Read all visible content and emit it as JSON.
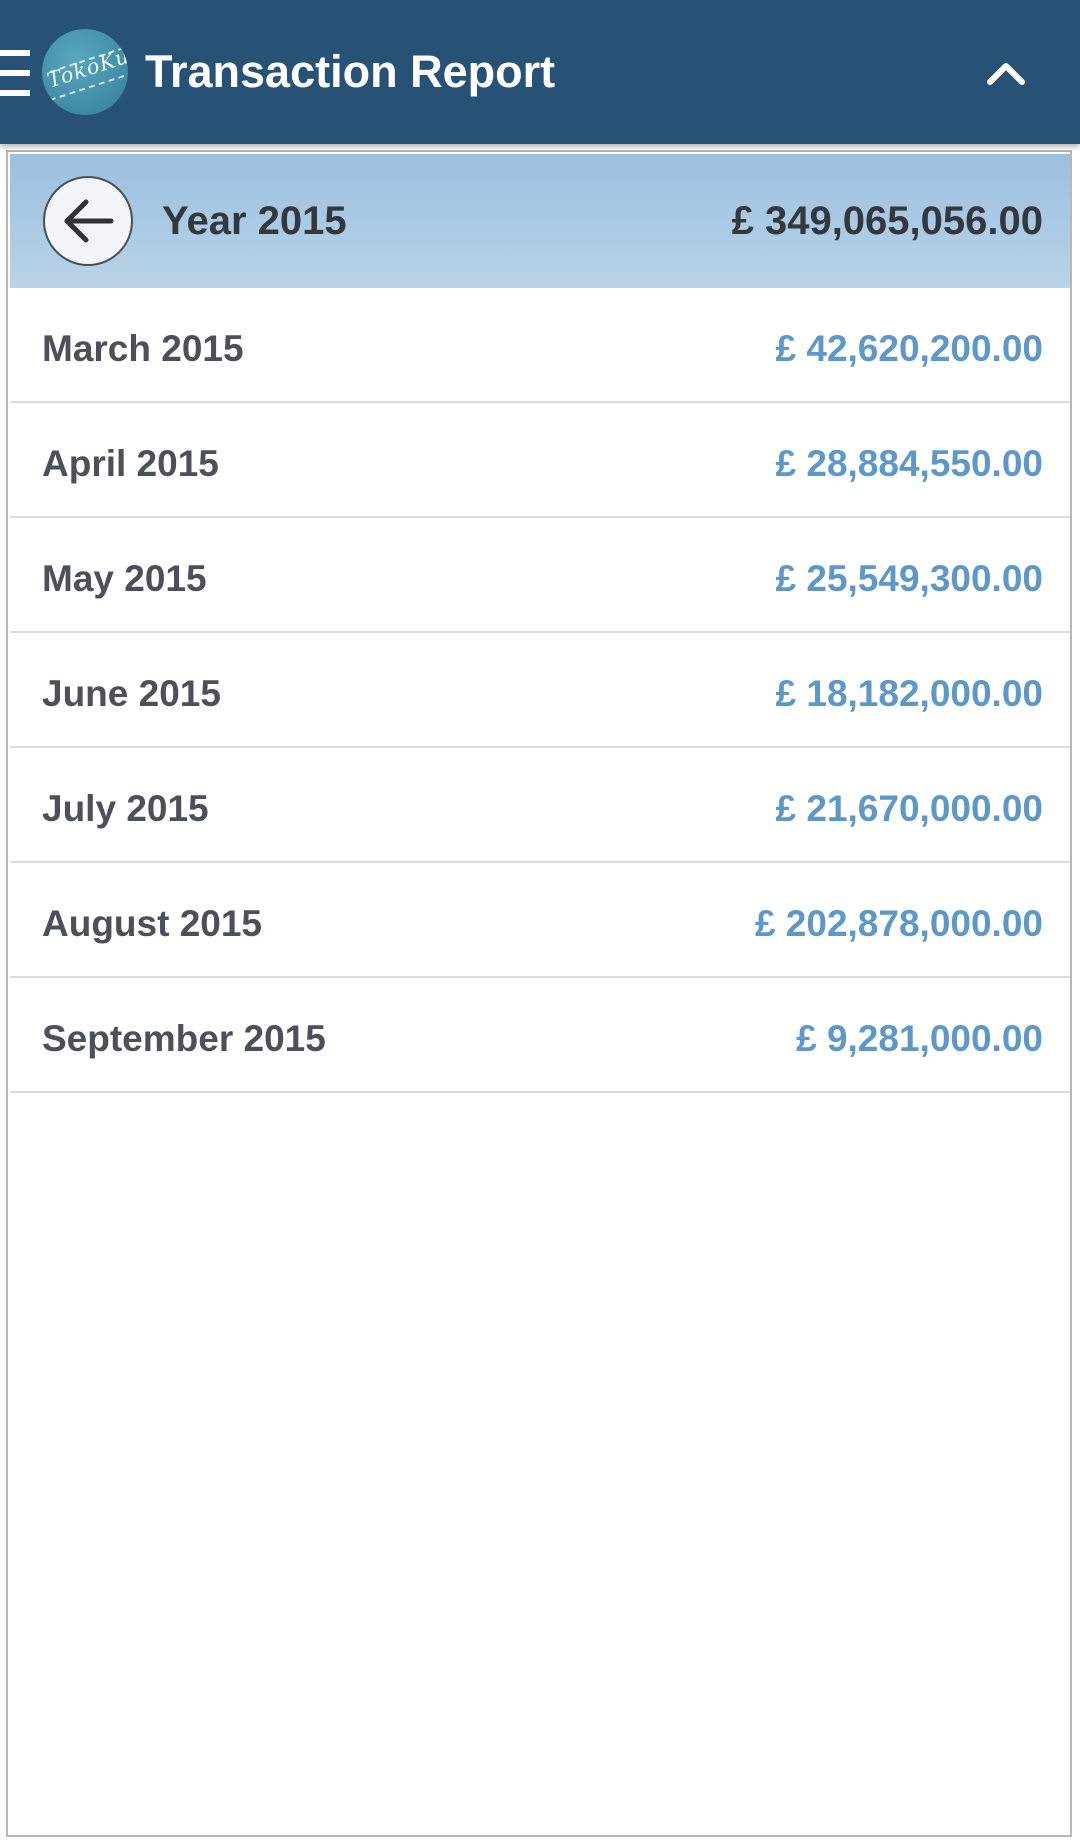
{
  "appbar": {
    "title": "Transaction Report",
    "logo_text": "TokoKu",
    "menu_icon": "hamburger-menu-icon",
    "collapse_icon": "chevron-up-icon"
  },
  "year_summary": {
    "label": "Year 2015",
    "total": "£ 349,065,056.00",
    "back_icon": "arrow-left-icon"
  },
  "months": [
    {
      "label": "March 2015",
      "amount": "£ 42,620,200.00"
    },
    {
      "label": "April 2015",
      "amount": "£ 28,884,550.00"
    },
    {
      "label": "May 2015",
      "amount": "£ 25,549,300.00"
    },
    {
      "label": "June 2015",
      "amount": "£ 18,182,000.00"
    },
    {
      "label": "July 2015",
      "amount": "£ 21,670,000.00"
    },
    {
      "label": "August 2015",
      "amount": "£ 202,878,000.00"
    },
    {
      "label": "September 2015",
      "amount": "£ 9,281,000.00"
    }
  ],
  "colors": {
    "appbar": "#285275",
    "header_gradient_top": "#9bbfdf",
    "header_gradient_bottom": "#b9d3e8",
    "amount": "#5e98c9",
    "text": "#4c505a"
  }
}
